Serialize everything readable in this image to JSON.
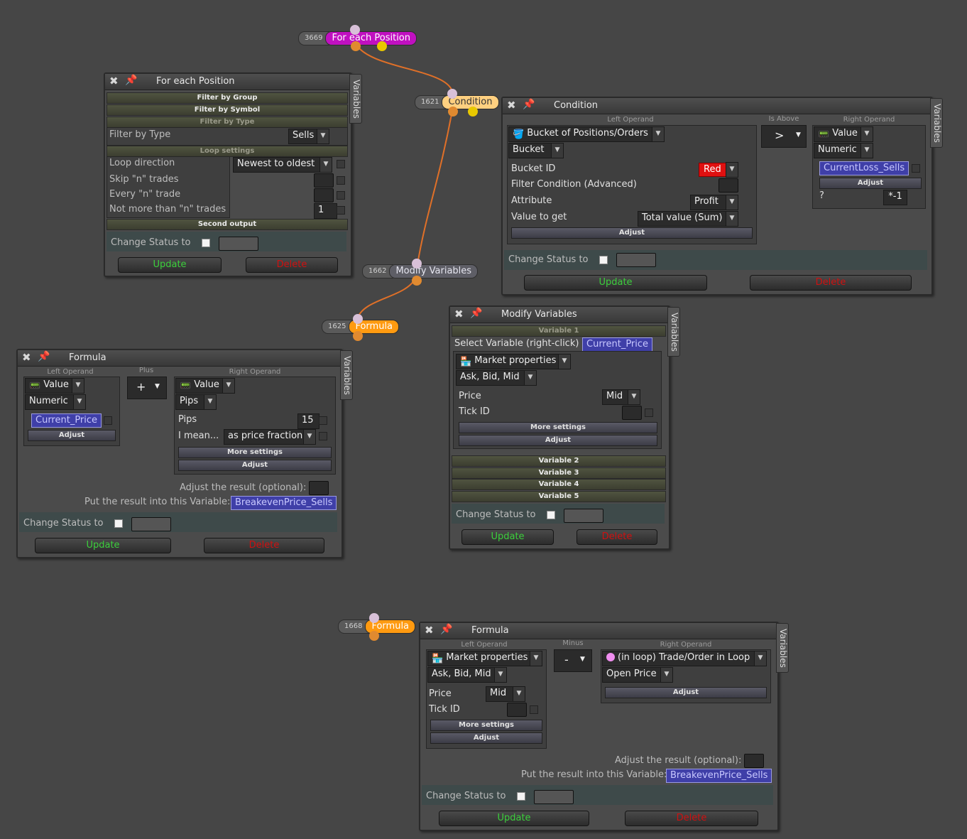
{
  "nodes": {
    "for_each": {
      "id": "3669",
      "label": "For each Position"
    },
    "condition": {
      "id": "1621",
      "label": "Condition"
    },
    "modify": {
      "id": "1662",
      "label": "Modify Variables"
    },
    "formula1": {
      "id": "1625",
      "label": "Formula"
    },
    "formula2": {
      "id": "1668",
      "label": "Formula"
    }
  },
  "common": {
    "variables_tab": "Variables",
    "change_status": "Change Status to",
    "update": "Update",
    "delete": "Delete",
    "adjust": "Adjust",
    "more_settings": "More settings",
    "left_operand": "Left Operand",
    "right_operand": "Right Operand"
  },
  "p_foreach": {
    "title": "For each Position",
    "filter_group": "Filter by Group",
    "filter_symbol": "Filter by Symbol",
    "filter_type_hdr": "Filter by Type",
    "filter_type_label": "Filter by Type",
    "filter_type_value": "Sells",
    "loop_settings": "Loop settings",
    "loop_direction_label": "Loop direction",
    "loop_direction_value": "Newest to oldest",
    "skip_label": "Skip \"n\" trades",
    "every_label": "Every \"n\" trade",
    "notmore_label": "Not more than \"n\" trades",
    "notmore_value": "1",
    "second_output": "Second output"
  },
  "p_condition": {
    "title": "Condition",
    "is_above": "Is Above",
    "left_source": "Bucket of Positions/Orders",
    "left_sub": "Bucket",
    "bucket_id_label": "Bucket ID",
    "bucket_id_value": "Red",
    "filter_label": "Filter Condition (Advanced)",
    "attribute_label": "Attribute",
    "attribute_value": "Profit",
    "value_get_label": "Value to get",
    "value_get_value": "Total value (Sum)",
    "operator": ">",
    "right_source": "Value",
    "right_type": "Numeric",
    "right_var": "CurrentLoss_Sells",
    "adjust_q": "?",
    "adjust_val": "*-1"
  },
  "p_modify": {
    "title": "Modify Variables",
    "var1": "Variable 1",
    "select_label": "Select Variable (right-click)",
    "select_value": "Current_Price",
    "source": "Market properties",
    "sub": "Ask, Bid, Mid",
    "price_label": "Price",
    "price_value": "Mid",
    "tick_label": "Tick ID",
    "var2": "Variable 2",
    "var3": "Variable 3",
    "var4": "Variable 4",
    "var5": "Variable 5"
  },
  "p_formula1": {
    "title": "Formula",
    "plus_hdr": "Plus",
    "operator": "+",
    "left_source": "Value",
    "left_type": "Numeric",
    "left_var": "Current_Price",
    "right_source": "Value",
    "right_type": "Pips",
    "pips_label": "Pips",
    "pips_value": "15",
    "mean_label": "I mean...",
    "mean_value": "as price fraction",
    "adjust_result": "Adjust the result (optional):",
    "put_result": "Put the result into this Variable:",
    "result_var": "BreakevenPrice_Sells"
  },
  "p_formula2": {
    "title": "Formula",
    "minus_hdr": "Minus",
    "operator": "-",
    "left_source": "Market properties",
    "left_sub": "Ask, Bid, Mid",
    "price_label": "Price",
    "price_value": "Mid",
    "tick_label": "Tick ID",
    "right_source": "(in loop) Trade/Order in Loop",
    "right_sub": "Open Price",
    "adjust_result": "Adjust the result (optional):",
    "put_result": "Put the result into this Variable:",
    "result_var": "BreakevenPrice_Sells"
  },
  "colors": {
    "for_each": "#c010c0",
    "condition": "#ffd080",
    "formula": "#ff9a10",
    "wire": "#e07028",
    "update": "#3ccf3c",
    "delete": "#d01010"
  }
}
